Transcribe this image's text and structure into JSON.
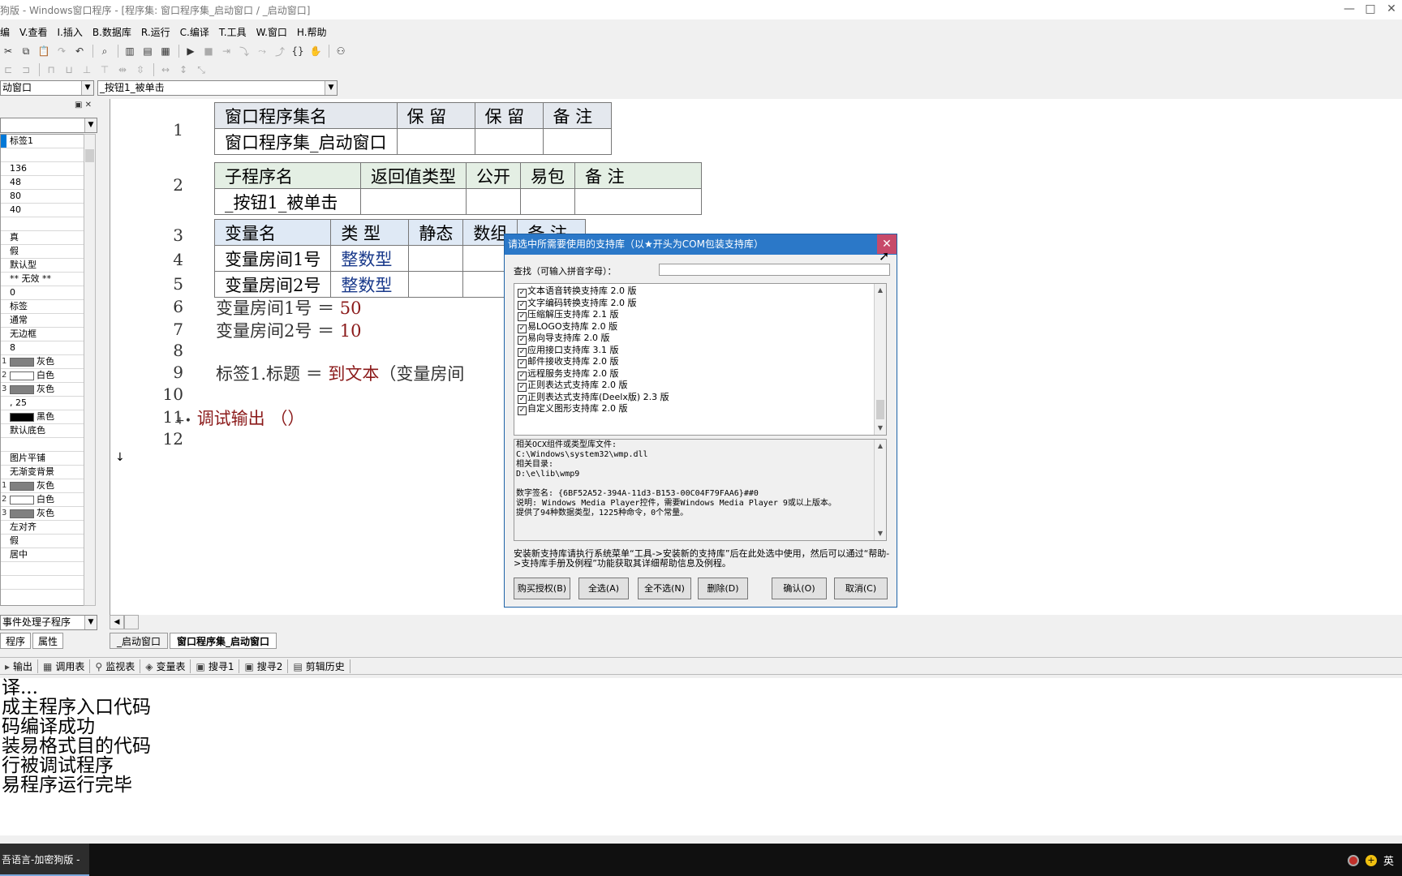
{
  "window": {
    "title": "狗版 - Windows窗口程序 - [程序集: 窗口程序集_启动窗口 / _启动窗口]",
    "controls": [
      "—",
      "□",
      "✕"
    ]
  },
  "menu": [
    "编",
    "V.查看",
    "I.插入",
    "B.数据库",
    "R.运行",
    "C.编译",
    "T.工具",
    "W.窗口",
    "H.帮助"
  ],
  "combos": {
    "window_select": "动窗口",
    "sub_select": "_按钮1_被单击"
  },
  "left_panel": {
    "event_combo": "事件处理子程序",
    "tabs": [
      "程序",
      "属性"
    ],
    "props": [
      {
        "text": "标签1",
        "swatch": null,
        "idx": ""
      },
      {
        "text": "",
        "swatch": null,
        "idx": ""
      },
      {
        "text": "136",
        "swatch": null,
        "idx": ""
      },
      {
        "text": "48",
        "swatch": null,
        "idx": ""
      },
      {
        "text": "80",
        "swatch": null,
        "idx": ""
      },
      {
        "text": "40",
        "swatch": null,
        "idx": ""
      },
      {
        "text": "",
        "swatch": null,
        "idx": ""
      },
      {
        "text": "真",
        "swatch": null,
        "idx": ""
      },
      {
        "text": "假",
        "swatch": null,
        "idx": ""
      },
      {
        "text": "默认型",
        "swatch": null,
        "idx": ""
      },
      {
        "text": "** 无效 **",
        "swatch": null,
        "idx": ""
      },
      {
        "text": "0",
        "swatch": null,
        "idx": ""
      },
      {
        "text": "标签",
        "swatch": null,
        "idx": ""
      },
      {
        "text": "通常",
        "swatch": null,
        "idx": ""
      },
      {
        "text": "无边框",
        "swatch": null,
        "idx": ""
      },
      {
        "text": "8",
        "swatch": null,
        "idx": ""
      },
      {
        "text": "灰色",
        "swatch": "#808080",
        "idx": "1"
      },
      {
        "text": "白色",
        "swatch": "#ffffff",
        "idx": "2"
      },
      {
        "text": "灰色",
        "swatch": "#808080",
        "idx": "3"
      },
      {
        "text": ", 25",
        "swatch": null,
        "idx": ""
      },
      {
        "text": "黑色",
        "swatch": "#000000",
        "idx": ""
      },
      {
        "text": "默认底色",
        "swatch": null,
        "idx": ""
      },
      {
        "text": "",
        "swatch": null,
        "idx": ""
      },
      {
        "text": "图片平铺",
        "swatch": null,
        "idx": ""
      },
      {
        "text": "无渐变背景",
        "swatch": null,
        "idx": ""
      },
      {
        "text": "灰色",
        "swatch": "#808080",
        "idx": "1"
      },
      {
        "text": "白色",
        "swatch": "#ffffff",
        "idx": "2"
      },
      {
        "text": "灰色",
        "swatch": "#808080",
        "idx": "3"
      },
      {
        "text": "左对齐",
        "swatch": null,
        "idx": ""
      },
      {
        "text": "假",
        "swatch": null,
        "idx": ""
      },
      {
        "text": "居中",
        "swatch": null,
        "idx": ""
      },
      {
        "text": "",
        "swatch": null,
        "idx": ""
      },
      {
        "text": "",
        "swatch": null,
        "idx": ""
      }
    ]
  },
  "editor": {
    "table1": {
      "headers": [
        "窗口程序集名",
        "保 留",
        "保 留",
        "备 注"
      ],
      "row": [
        "窗口程序集_启动窗口",
        "",
        "",
        ""
      ]
    },
    "table2": {
      "headers": [
        "子程序名",
        "返回值类型",
        "公开",
        "易包",
        "备 注"
      ],
      "row": [
        "_按钮1_被单击",
        "",
        "",
        "",
        ""
      ]
    },
    "table3": {
      "headers": [
        "变量名",
        "类 型",
        "静态",
        "数组",
        "备 注"
      ],
      "rows": [
        [
          "变量房间1号",
          "整数型",
          "",
          "",
          ""
        ],
        [
          "变量房间2号",
          "整数型",
          "",
          "",
          ""
        ]
      ]
    },
    "line_numbers": [
      "1",
      "2",
      "3",
      "4",
      "5",
      "6",
      "7",
      "8",
      "9",
      "10",
      "11",
      "12"
    ],
    "code": {
      "l6_var": "变量房间1号",
      "l6_op": "＝",
      "l6_val": "50",
      "l7_var": "变量房间2号",
      "l7_op": "＝",
      "l7_val": "10",
      "l9_lhs": "标签1.标题",
      "l9_op": "＝",
      "l9_fn": "到文本",
      "l9_arg": "（变量房间",
      "l11_prefix": "+•",
      "l11_fn": "调试输出",
      "l11_paren": "（）"
    },
    "gutter_arrow": "↓"
  },
  "doc_tabs": [
    "_启动窗口",
    "窗口程序集_启动窗口"
  ],
  "output_tabs": [
    {
      "icon": "▸",
      "label": "输出"
    },
    {
      "icon": "▦",
      "label": "调用表"
    },
    {
      "icon": "⚲",
      "label": "监视表"
    },
    {
      "icon": "◈",
      "label": "变量表"
    },
    {
      "icon": "▣",
      "label": "搜寻1"
    },
    {
      "icon": "▣",
      "label": "搜寻2"
    },
    {
      "icon": "▤",
      "label": "剪辑历史"
    }
  ],
  "output_lines": [
    "译...",
    "成主程序入口代码",
    "码编译成功",
    "装易格式目的代码",
    "行被调试程序",
    "易程序运行完毕"
  ],
  "taskbar": {
    "app": "吾语言-加密狗版 - ...",
    "ime": "英"
  },
  "dialog": {
    "title": "请选中所需要使用的支持库（以★开头为COM包装支持库）",
    "search_label": "查找（可输入拼音字母）：",
    "search_value": "",
    "libraries": [
      {
        "checked": true,
        "name": "文本语音转换支持库 2.0 版"
      },
      {
        "checked": true,
        "name": "文字编码转换支持库 2.0 版"
      },
      {
        "checked": true,
        "name": "压缩解压支持库 2.1 版"
      },
      {
        "checked": true,
        "name": "易LOGO支持库 2.0 版"
      },
      {
        "checked": true,
        "name": "易向导支持库 2.0 版"
      },
      {
        "checked": true,
        "name": "应用接口支持库 3.1 版"
      },
      {
        "checked": true,
        "name": "邮件接收支持库 2.0 版"
      },
      {
        "checked": true,
        "name": "远程服务支持库 2.0 版"
      },
      {
        "checked": true,
        "name": "正则表达式支持库 2.0 版"
      },
      {
        "checked": true,
        "name": "正则表达式支持库(Deelx版) 2.3 版"
      },
      {
        "checked": true,
        "name": "自定义图形支持库 2.0 版"
      }
    ],
    "info_lines": [
      "相关OCX组件或类型库文件:",
      "C:\\Windows\\system32\\wmp.dll",
      "相关目录:",
      "D:\\e\\lib\\wmp9",
      "",
      "数字签名: {6BF52A52-394A-11d3-B153-00C04F79FAA6}##0",
      "说明:  Windows Media Player控件，需要Windows Media Player 9或以上版本。",
      "提供了94种数据类型，1225种命令，0个常量。"
    ],
    "note": "安装新支持库请执行系统菜单“工具->安装新的支持库”后在此处选中使用，然后可以通过“帮助->支持库手册及例程”功能获取其详细帮助信息及例程。",
    "buttons": {
      "buy": "购买授权(B)",
      "select_all": "全选(A)",
      "select_none": "全不选(N)",
      "delete": "删除(D)",
      "ok": "确认(O)",
      "cancel": "取消(C)"
    }
  },
  "colors": {
    "keyword": "#8b1a1a",
    "type": "#1a3a8b",
    "dialog_title_bg": "#2b78c8",
    "close_button": "#c74a6a"
  }
}
